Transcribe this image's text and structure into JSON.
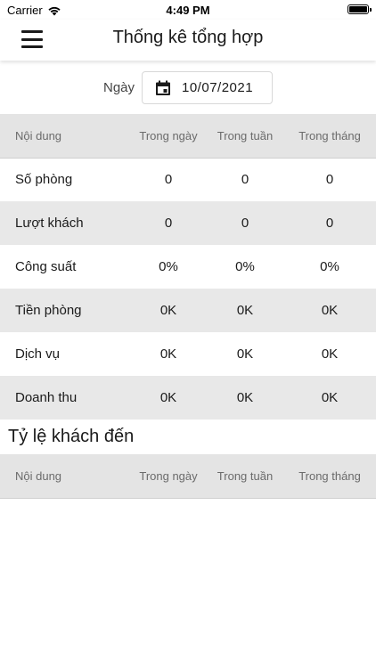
{
  "status_bar": {
    "carrier": "Carrier",
    "time": "4:49 PM"
  },
  "header": {
    "title": "Thống kê tổng hợp",
    "menu_icon": "hamburger-menu-icon"
  },
  "date_filter": {
    "label": "Ngày",
    "value": "10/07/2021",
    "icon": "calendar-icon"
  },
  "summary_table": {
    "columns": [
      "Nội dung",
      "Trong ngày",
      "Trong tuần",
      "Trong tháng"
    ],
    "rows": [
      {
        "label": "Số phòng",
        "day": "0",
        "week": "0",
        "month": "0"
      },
      {
        "label": "Lượt khách",
        "day": "0",
        "week": "0",
        "month": "0"
      },
      {
        "label": "Công suất",
        "day": "0%",
        "week": "0%",
        "month": "0%"
      },
      {
        "label": "Tiền phòng",
        "day": "0K",
        "week": "0K",
        "month": "0K"
      },
      {
        "label": "Dịch vụ",
        "day": "0K",
        "week": "0K",
        "month": "0K"
      },
      {
        "label": "Doanh thu",
        "day": "0K",
        "week": "0K",
        "month": "0K"
      }
    ]
  },
  "guest_ratio": {
    "title": "Tỷ lệ khách đến",
    "columns": [
      "Nội dung",
      "Trong ngày",
      "Trong tuần",
      "Trong tháng"
    ]
  }
}
